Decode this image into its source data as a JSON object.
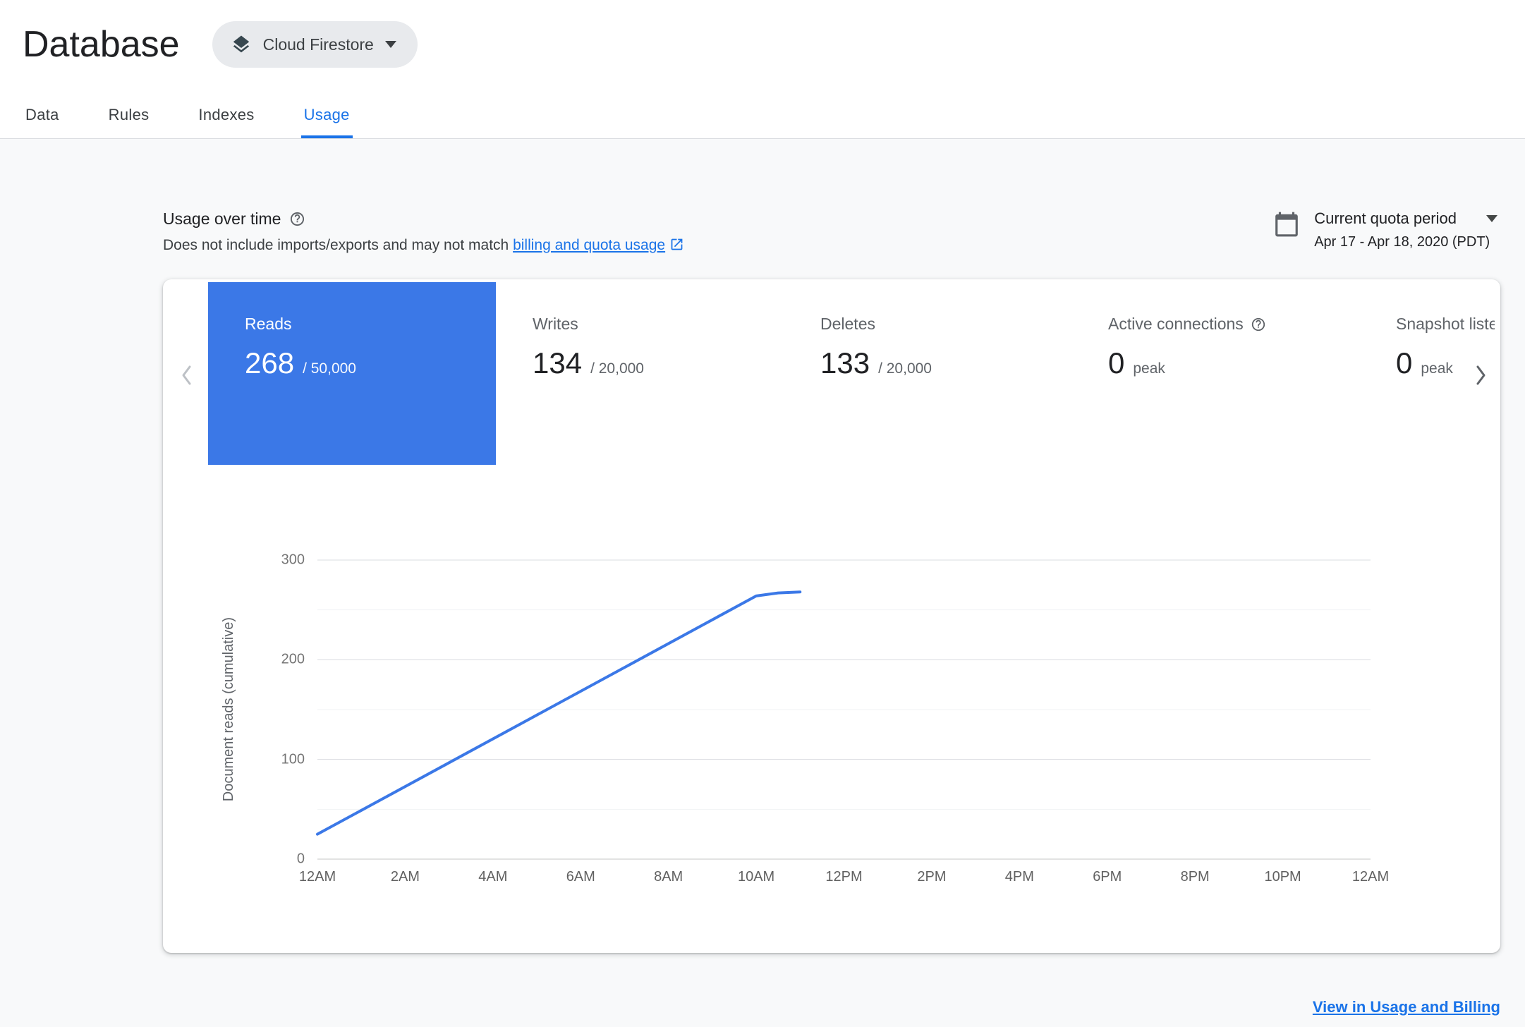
{
  "page": {
    "title": "Database"
  },
  "header": {
    "product_selector": {
      "label": "Cloud Firestore"
    },
    "tabs": [
      {
        "label": "Data"
      },
      {
        "label": "Rules"
      },
      {
        "label": "Indexes"
      },
      {
        "label": "Usage",
        "active": true
      }
    ]
  },
  "usage_section": {
    "title": "Usage over time",
    "subtitle_prefix": "Does not include imports/exports and may not match ",
    "subtitle_link": "billing and quota usage",
    "quota_period": {
      "label": "Current quota period",
      "range": "Apr 17 - Apr 18, 2020 (PDT)"
    }
  },
  "metrics": [
    {
      "label": "Reads",
      "value": "268",
      "suffix": "/ 50,000",
      "selected": true
    },
    {
      "label": "Writes",
      "value": "134",
      "suffix": "/ 20,000"
    },
    {
      "label": "Deletes",
      "value": "133",
      "suffix": "/ 20,000"
    },
    {
      "label": "Active connections",
      "value": "0",
      "suffix": "peak"
    },
    {
      "label": "Snapshot listeners",
      "value": "0",
      "suffix": "peak"
    }
  ],
  "footer": {
    "link": "View in Usage and Billing"
  },
  "colors": {
    "selected_tile": "#3b78e7",
    "accent_blue": "#1a73e8",
    "line_blue": "#3b78e7"
  },
  "chart_data": {
    "type": "line",
    "title": "Document reads (cumulative)",
    "ylabel": "Document reads (cumulative)",
    "xlabel": "",
    "x_range_hours": [
      0,
      24
    ],
    "x_tick_labels": [
      "12AM",
      "2AM",
      "4AM",
      "6AM",
      "8AM",
      "10AM",
      "12PM",
      "2PM",
      "4PM",
      "6PM",
      "8PM",
      "10PM",
      "12AM"
    ],
    "ylim": [
      0,
      300
    ],
    "y_ticks": [
      0,
      100,
      200,
      300
    ],
    "y_minor_ticks": [
      50,
      150,
      250
    ],
    "grid": true,
    "legend": "none",
    "series": [
      {
        "name": "Document reads (cumulative)",
        "color": "#3b78e7",
        "points": [
          [
            0,
            25
          ],
          [
            10,
            264
          ],
          [
            10.5,
            267
          ],
          [
            11,
            268
          ]
        ]
      }
    ]
  }
}
